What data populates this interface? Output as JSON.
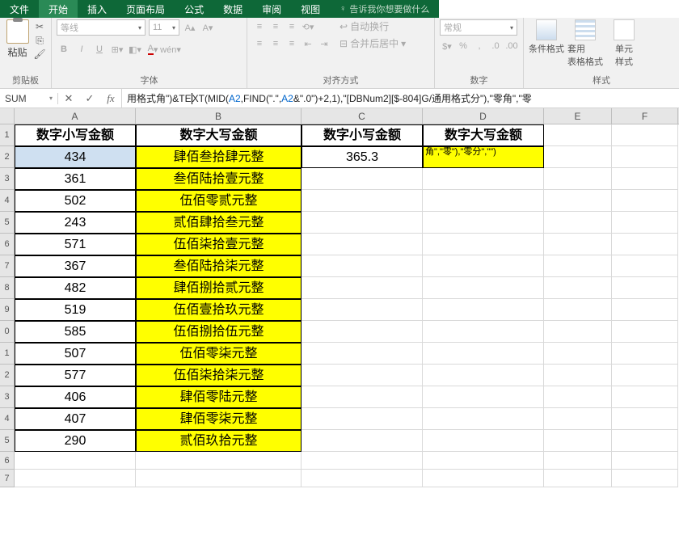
{
  "tabs": {
    "file": "文件",
    "home": "开始",
    "insert": "插入",
    "layout": "页面布局",
    "formulas": "公式",
    "data": "数据",
    "review": "审阅",
    "view": "视图",
    "tell": "告诉我你想要做什么"
  },
  "ribbon": {
    "paste": "粘贴",
    "clipboard": "剪贴板",
    "font_name": "等线",
    "font_size": "11",
    "font": "字体",
    "alignment": "对齐方式",
    "wrap": "自动换行",
    "merge": "合并后居中",
    "number_format": "常规",
    "number": "数字",
    "cond_format": "条件格式",
    "table_format": "套用\n表格格式",
    "cell_style": "单元\n样式"
  },
  "namebox": "SUM",
  "formula": {
    "p1": "用格式角\")&TE",
    "p2": "T(MID(",
    "ref1": "A2",
    "p3": ",FIND(\".\",",
    "ref2": "A2",
    "p4": "&\".0\")+2,1),\"[DBNum2][$-804]G/通用格式分\"),\"零角\",\"零"
  },
  "columns": [
    "A",
    "B",
    "C",
    "D",
    "E",
    "F"
  ],
  "headers": {
    "a": "数字小写金额",
    "b": "数字大写金额",
    "c": "数字小写金额",
    "d": "数字大写金额"
  },
  "cellD2": "角\",\"零\"),\"零分\",\"\")",
  "data_rows": [
    {
      "n": "2",
      "a": "434",
      "b": "肆佰叁拾肆元整",
      "c": "365.3"
    },
    {
      "n": "3",
      "a": "361",
      "b": "叁佰陆拾壹元整",
      "c": ""
    },
    {
      "n": "4",
      "a": "502",
      "b": "伍佰零贰元整",
      "c": ""
    },
    {
      "n": "5",
      "a": "243",
      "b": "贰佰肆拾叁元整",
      "c": ""
    },
    {
      "n": "6",
      "a": "571",
      "b": "伍佰柒拾壹元整",
      "c": ""
    },
    {
      "n": "7",
      "a": "367",
      "b": "叁佰陆拾柒元整",
      "c": ""
    },
    {
      "n": "8",
      "a": "482",
      "b": "肆佰捌拾贰元整",
      "c": ""
    },
    {
      "n": "9",
      "a": "519",
      "b": "伍佰壹拾玖元整",
      "c": ""
    },
    {
      "n": "0",
      "a": "585",
      "b": "伍佰捌拾伍元整",
      "c": ""
    },
    {
      "n": "1",
      "a": "507",
      "b": "伍佰零柒元整",
      "c": ""
    },
    {
      "n": "2",
      "a": "577",
      "b": "伍佰柒拾柒元整",
      "c": ""
    },
    {
      "n": "3",
      "a": "406",
      "b": "肆佰零陆元整",
      "c": ""
    },
    {
      "n": "4",
      "a": "407",
      "b": "肆佰零柒元整",
      "c": ""
    },
    {
      "n": "5",
      "a": "290",
      "b": "贰佰玖拾元整",
      "c": ""
    }
  ],
  "empty_rows": [
    "6",
    "7"
  ]
}
